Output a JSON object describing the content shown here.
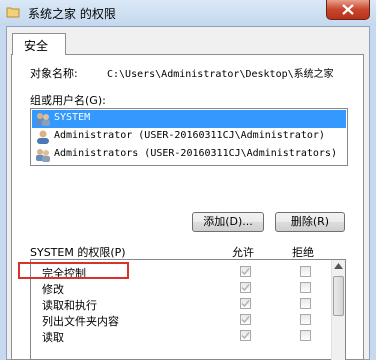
{
  "window": {
    "title": "系统之家 的权限",
    "close_label": "X"
  },
  "tabs": [
    {
      "label": "安全"
    }
  ],
  "object": {
    "label": "对象名称:",
    "path": "C:\\Users\\Administrator\\Desktop\\系统之家"
  },
  "groups": {
    "label": "组或用户名(G):",
    "items": [
      {
        "text": "SYSTEM",
        "selected": true,
        "icon": "user-group-icon"
      },
      {
        "text": "Administrator (USER-20160311CJ\\Administrator)",
        "selected": false,
        "icon": "user-icon"
      },
      {
        "text": "Administrators (USER-20160311CJ\\Administrators)",
        "selected": false,
        "icon": "user-group-icon"
      }
    ],
    "add_button": "添加(D)...",
    "remove_button": "删除(R)"
  },
  "permissions": {
    "header_label": "SYSTEM 的权限(P)",
    "allow_label": "允许",
    "deny_label": "拒绝",
    "rows": [
      {
        "name": "完全控制",
        "allow": true,
        "deny": false,
        "highlighted": true
      },
      {
        "name": "修改",
        "allow": true,
        "deny": false
      },
      {
        "name": "读取和执行",
        "allow": true,
        "deny": false
      },
      {
        "name": "列出文件夹内容",
        "allow": true,
        "deny": false
      },
      {
        "name": "读取",
        "allow": true,
        "deny": false
      }
    ]
  },
  "colors": {
    "selection": "#3399ff",
    "highlight_border": "#d9322a",
    "close_button": "#c9452c"
  }
}
